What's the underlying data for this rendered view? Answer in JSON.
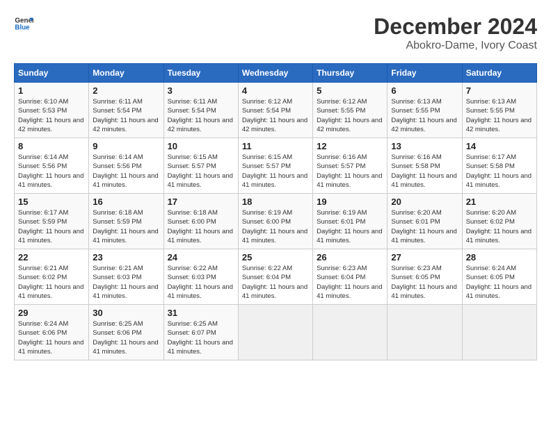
{
  "header": {
    "logo_line1": "General",
    "logo_line2": "Blue",
    "month": "December 2024",
    "location": "Abokro-Dame, Ivory Coast"
  },
  "weekdays": [
    "Sunday",
    "Monday",
    "Tuesday",
    "Wednesday",
    "Thursday",
    "Friday",
    "Saturday"
  ],
  "weeks": [
    [
      {
        "day": "1",
        "sunrise": "6:10 AM",
        "sunset": "5:53 PM",
        "daylight": "11 hours and 42 minutes."
      },
      {
        "day": "2",
        "sunrise": "6:11 AM",
        "sunset": "5:54 PM",
        "daylight": "11 hours and 42 minutes."
      },
      {
        "day": "3",
        "sunrise": "6:11 AM",
        "sunset": "5:54 PM",
        "daylight": "11 hours and 42 minutes."
      },
      {
        "day": "4",
        "sunrise": "6:12 AM",
        "sunset": "5:54 PM",
        "daylight": "11 hours and 42 minutes."
      },
      {
        "day": "5",
        "sunrise": "6:12 AM",
        "sunset": "5:55 PM",
        "daylight": "11 hours and 42 minutes."
      },
      {
        "day": "6",
        "sunrise": "6:13 AM",
        "sunset": "5:55 PM",
        "daylight": "11 hours and 42 minutes."
      },
      {
        "day": "7",
        "sunrise": "6:13 AM",
        "sunset": "5:55 PM",
        "daylight": "11 hours and 42 minutes."
      }
    ],
    [
      {
        "day": "8",
        "sunrise": "6:14 AM",
        "sunset": "5:56 PM",
        "daylight": "11 hours and 41 minutes."
      },
      {
        "day": "9",
        "sunrise": "6:14 AM",
        "sunset": "5:56 PM",
        "daylight": "11 hours and 41 minutes."
      },
      {
        "day": "10",
        "sunrise": "6:15 AM",
        "sunset": "5:57 PM",
        "daylight": "11 hours and 41 minutes."
      },
      {
        "day": "11",
        "sunrise": "6:15 AM",
        "sunset": "5:57 PM",
        "daylight": "11 hours and 41 minutes."
      },
      {
        "day": "12",
        "sunrise": "6:16 AM",
        "sunset": "5:57 PM",
        "daylight": "11 hours and 41 minutes."
      },
      {
        "day": "13",
        "sunrise": "6:16 AM",
        "sunset": "5:58 PM",
        "daylight": "11 hours and 41 minutes."
      },
      {
        "day": "14",
        "sunrise": "6:17 AM",
        "sunset": "5:58 PM",
        "daylight": "11 hours and 41 minutes."
      }
    ],
    [
      {
        "day": "15",
        "sunrise": "6:17 AM",
        "sunset": "5:59 PM",
        "daylight": "11 hours and 41 minutes."
      },
      {
        "day": "16",
        "sunrise": "6:18 AM",
        "sunset": "5:59 PM",
        "daylight": "11 hours and 41 minutes."
      },
      {
        "day": "17",
        "sunrise": "6:18 AM",
        "sunset": "6:00 PM",
        "daylight": "11 hours and 41 minutes."
      },
      {
        "day": "18",
        "sunrise": "6:19 AM",
        "sunset": "6:00 PM",
        "daylight": "11 hours and 41 minutes."
      },
      {
        "day": "19",
        "sunrise": "6:19 AM",
        "sunset": "6:01 PM",
        "daylight": "11 hours and 41 minutes."
      },
      {
        "day": "20",
        "sunrise": "6:20 AM",
        "sunset": "6:01 PM",
        "daylight": "11 hours and 41 minutes."
      },
      {
        "day": "21",
        "sunrise": "6:20 AM",
        "sunset": "6:02 PM",
        "daylight": "11 hours and 41 minutes."
      }
    ],
    [
      {
        "day": "22",
        "sunrise": "6:21 AM",
        "sunset": "6:02 PM",
        "daylight": "11 hours and 41 minutes."
      },
      {
        "day": "23",
        "sunrise": "6:21 AM",
        "sunset": "6:03 PM",
        "daylight": "11 hours and 41 minutes."
      },
      {
        "day": "24",
        "sunrise": "6:22 AM",
        "sunset": "6:03 PM",
        "daylight": "11 hours and 41 minutes."
      },
      {
        "day": "25",
        "sunrise": "6:22 AM",
        "sunset": "6:04 PM",
        "daylight": "11 hours and 41 minutes."
      },
      {
        "day": "26",
        "sunrise": "6:23 AM",
        "sunset": "6:04 PM",
        "daylight": "11 hours and 41 minutes."
      },
      {
        "day": "27",
        "sunrise": "6:23 AM",
        "sunset": "6:05 PM",
        "daylight": "11 hours and 41 minutes."
      },
      {
        "day": "28",
        "sunrise": "6:24 AM",
        "sunset": "6:05 PM",
        "daylight": "11 hours and 41 minutes."
      }
    ],
    [
      {
        "day": "29",
        "sunrise": "6:24 AM",
        "sunset": "6:06 PM",
        "daylight": "11 hours and 41 minutes."
      },
      {
        "day": "30",
        "sunrise": "6:25 AM",
        "sunset": "6:06 PM",
        "daylight": "11 hours and 41 minutes."
      },
      {
        "day": "31",
        "sunrise": "6:25 AM",
        "sunset": "6:07 PM",
        "daylight": "11 hours and 41 minutes."
      },
      null,
      null,
      null,
      null
    ]
  ]
}
